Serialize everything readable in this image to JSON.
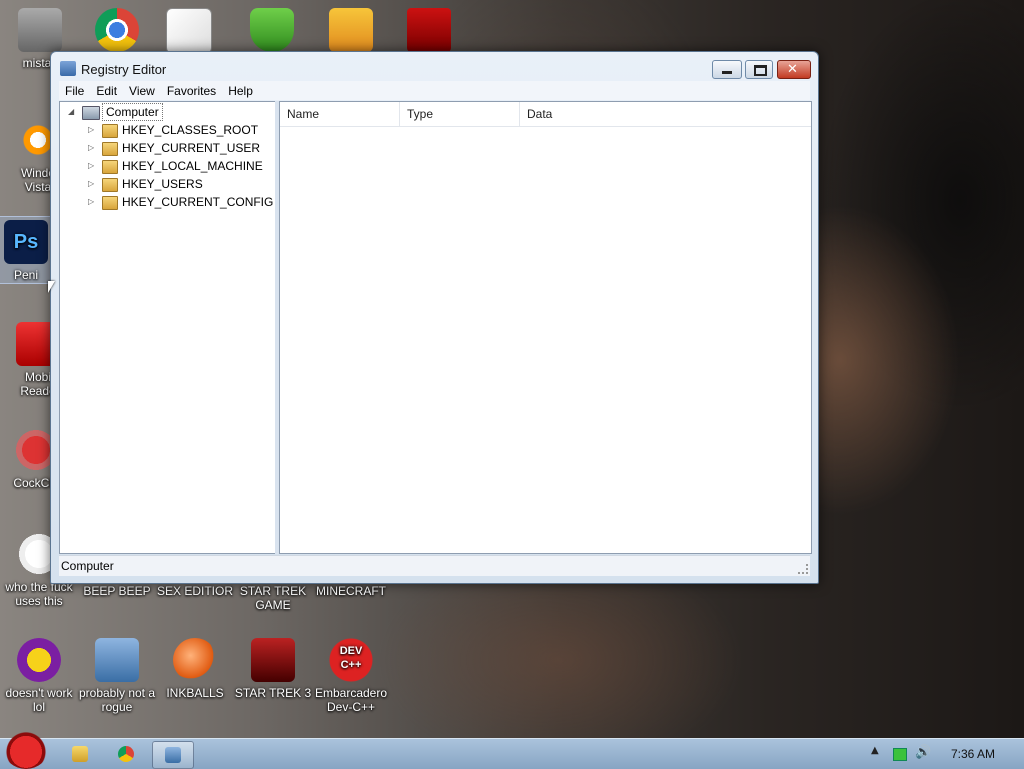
{
  "desktop": {
    "icons": {
      "mistake": "mistak",
      "vista": "Windo\nVista",
      "ps": "Peni",
      "mobi": "Mobi\nReade",
      "ccleaner": "CockCle",
      "flash": "who the fuck uses this",
      "beep": "BEEP BEEP",
      "sex": "SEX EDITIOR",
      "startrek_game": "STAR TREK GAME",
      "minecraft": "MINECRAFT",
      "yahoo": "doesn't work lol",
      "rogue": "probably not a rogue",
      "inkballs": "INKBALLS",
      "startrek3": "STAR TREK 3",
      "devcpp": "Embarcadero Dev-C++",
      "ps_glyph": "Ps",
      "dev_glyph": "DEV C++"
    }
  },
  "window": {
    "title": "Registry Editor",
    "menu": [
      "File",
      "Edit",
      "View",
      "Favorites",
      "Help"
    ],
    "tree": {
      "root": "Computer",
      "keys": [
        "HKEY_CLASSES_ROOT",
        "HKEY_CURRENT_USER",
        "HKEY_LOCAL_MACHINE",
        "HKEY_USERS",
        "HKEY_CURRENT_CONFIG"
      ]
    },
    "columns": [
      "Name",
      "Type",
      "Data"
    ],
    "status": "Computer"
  },
  "taskbar": {
    "clock": "7:36 AM"
  }
}
